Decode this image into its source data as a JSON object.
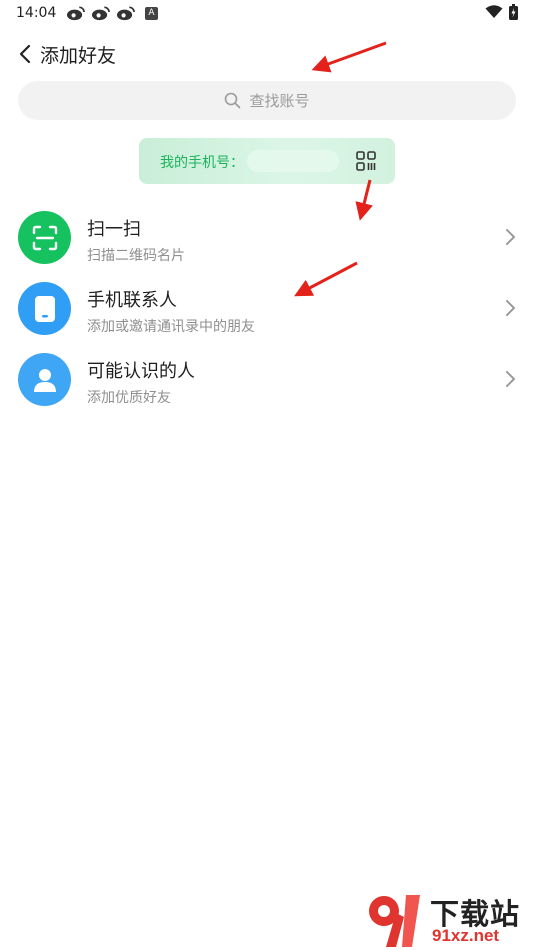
{
  "status_bar": {
    "time": "14:04",
    "badge_letter": "A",
    "icons": [
      "weibo-icon",
      "weibo-icon",
      "weibo-icon",
      "a-badge-icon",
      "wifi-icon",
      "battery-icon"
    ]
  },
  "header": {
    "back_icon": "chevron-left-icon",
    "title": "添加好友"
  },
  "search": {
    "icon": "search-icon",
    "placeholder": "查找账号"
  },
  "phone_card": {
    "label": "我的手机号：",
    "value_hidden": true,
    "qr_icon": "qr-code-icon",
    "accent": "#1bb45a"
  },
  "menu": {
    "items": [
      {
        "title": "扫一扫",
        "subtitle": "扫描二维码名片",
        "icon": "scan-icon",
        "color": "#16c25f"
      },
      {
        "title": "手机联系人",
        "subtitle": "添加或邀请通讯录中的朋友",
        "icon": "phone-icon",
        "color": "#2f9ef4"
      },
      {
        "title": "可能认识的人",
        "subtitle": "添加优质好友",
        "icon": "person-icon",
        "color": "#3ea6f5"
      }
    ]
  },
  "watermark": {
    "title": "下载站",
    "domain": "91xz.net"
  }
}
